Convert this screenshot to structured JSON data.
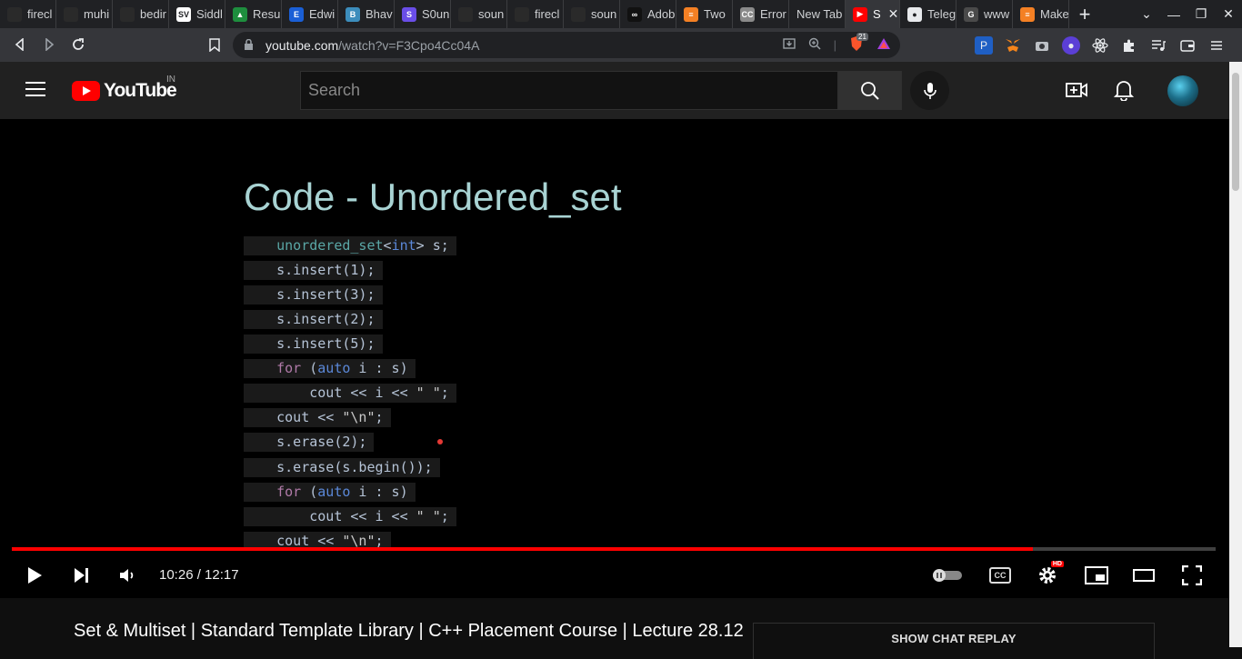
{
  "browser": {
    "tabs": [
      {
        "label": "firecl",
        "fav_color": "#2a2a2a",
        "fav_text": ""
      },
      {
        "label": "muhi",
        "fav_color": "#2a2a2a",
        "fav_text": ""
      },
      {
        "label": "bedir",
        "fav_color": "#2a2a2a",
        "fav_text": ""
      },
      {
        "label": "Siddl",
        "fav_color": "#ffffff",
        "fav_text": "SV"
      },
      {
        "label": "Resu",
        "fav_color": "#1e8e3e",
        "fav_text": "▲"
      },
      {
        "label": "Edwi",
        "fav_color": "#1a5fd6",
        "fav_text": "E"
      },
      {
        "label": "Bhav",
        "fav_color": "#3c8dbc",
        "fav_text": "B"
      },
      {
        "label": "S0un",
        "fav_color": "#6a4ee8",
        "fav_text": "S"
      },
      {
        "label": "soun",
        "fav_color": "#2a2a2a",
        "fav_text": ""
      },
      {
        "label": "firecl",
        "fav_color": "#2a2a2a",
        "fav_text": ""
      },
      {
        "label": "soun",
        "fav_color": "#2a2a2a",
        "fav_text": ""
      },
      {
        "label": "Adob",
        "fav_color": "#111111",
        "fav_text": "∞"
      },
      {
        "label": "Two",
        "fav_color": "#f48024",
        "fav_text": "≡"
      },
      {
        "label": "Error",
        "fav_color": "#8a8a8a",
        "fav_text": "CC"
      },
      {
        "label": "New Tab",
        "fav_color": "",
        "fav_text": ""
      },
      {
        "label": "S",
        "fav_color": "#ff0000",
        "fav_text": "▶",
        "active": true
      },
      {
        "label": "Teleg",
        "fav_color": "#e8eaed",
        "fav_text": "●"
      },
      {
        "label": "www",
        "fav_color": "#4a4a4a",
        "fav_text": "G"
      },
      {
        "label": "Make",
        "fav_color": "#f48024",
        "fav_text": "≡"
      }
    ],
    "url_host": "youtube.com",
    "url_path": "/watch?v=F3Cpo4Cc04A",
    "brave_count": "21"
  },
  "masthead": {
    "logo_text": "YouTube",
    "country": "IN",
    "search_placeholder": "Search"
  },
  "slide": {
    "title": "Code - Unordered_set"
  },
  "player": {
    "time": "10:26 / 12:17",
    "progress_fraction": 0.848,
    "hd_badge": "HD",
    "cc_label": "CC"
  },
  "video": {
    "title": "Set & Multiset | Standard Template Library | C++ Placement Course | Lecture 28.12",
    "chat_replay": "SHOW CHAT REPLAY"
  }
}
